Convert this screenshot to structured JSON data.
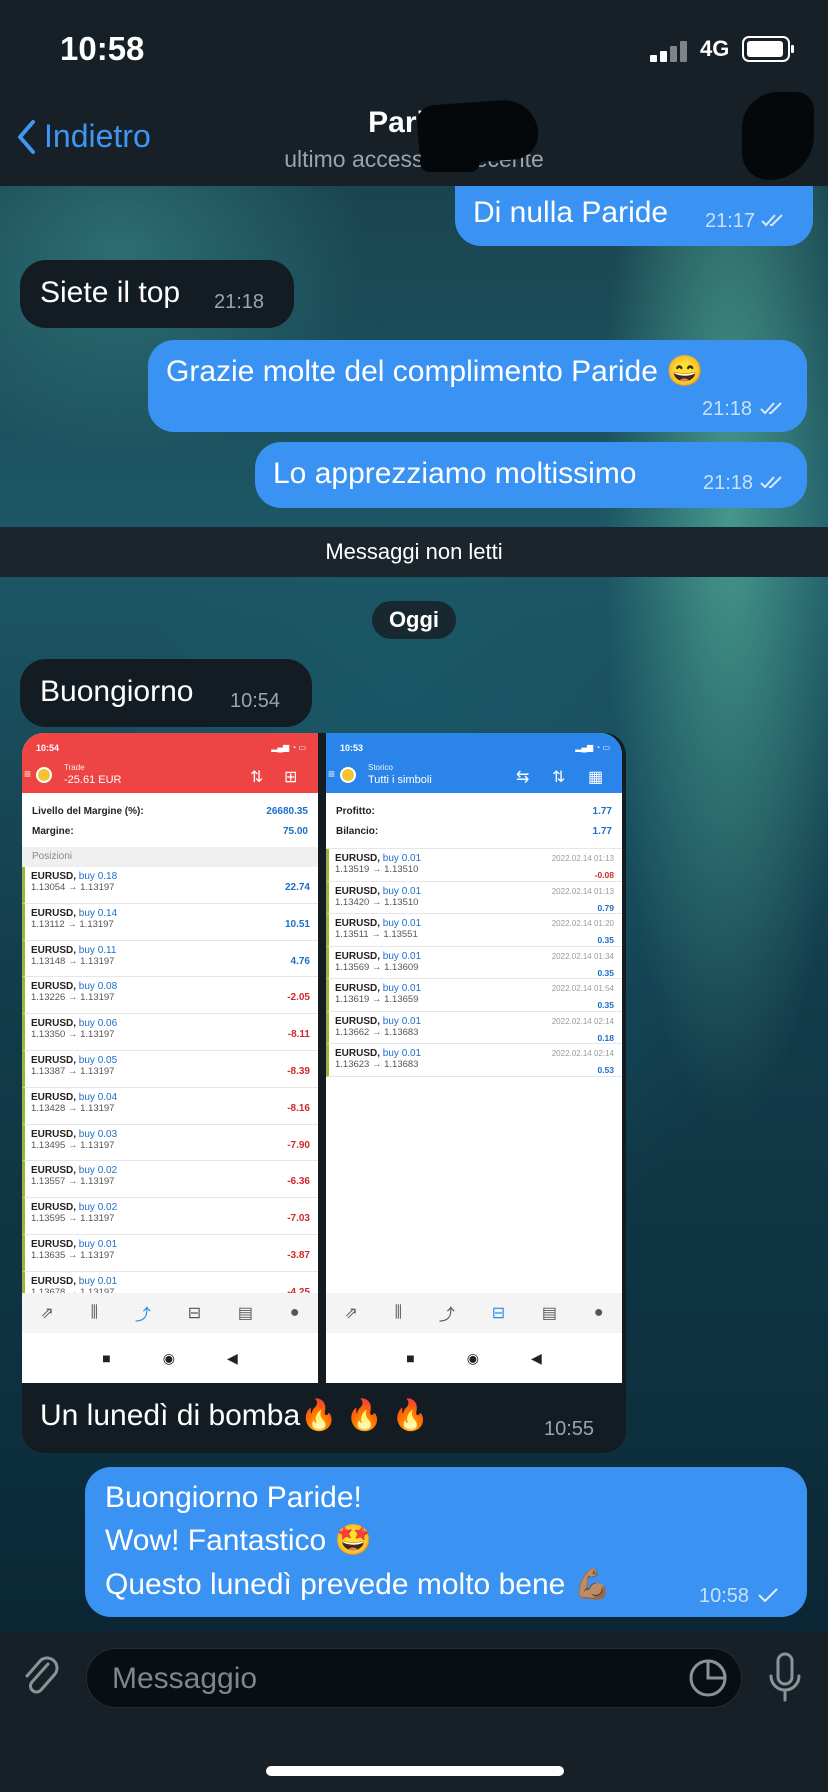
{
  "status": {
    "time": "10:58",
    "network": "4G"
  },
  "nav": {
    "back_label": "Indietro",
    "title": "Paride",
    "subtitle": "ultimo accesso di recente"
  },
  "messages": {
    "m1": {
      "text": "Di nulla Paride",
      "time": "21:17"
    },
    "m2": {
      "text": "Siete il top",
      "time": "21:18"
    },
    "m3": {
      "text": "Grazie molte del complimento Paride 😄",
      "time": "21:18"
    },
    "m4": {
      "text": "Lo apprezziamo moltissimo",
      "time": "21:18"
    },
    "unread": "Messaggi non letti",
    "date": "Oggi",
    "m5": {
      "text": "Buongiorno",
      "time": "10:54"
    },
    "m6": {
      "caption": "Un lunedì di bomba🔥 🔥 🔥",
      "time": "10:55"
    },
    "m7": {
      "line1": "Buongiorno Paride!",
      "line2": "Wow! Fantastico 🤩",
      "line3": "Questo lunedì prevede molto bene 💪🏽",
      "time": "10:58"
    }
  },
  "trade": {
    "time": "10:54",
    "header_label": "Trade",
    "header_value": "-25.61 EUR",
    "margin_level_label": "Livello del Margine (%):",
    "margin_level_value": "26680.35",
    "margin_label": "Margine:",
    "margin_value": "75.00",
    "section": "Posizioni",
    "rows": [
      {
        "sym": "EURUSD,",
        "side": "buy 0.18",
        "prices": "1.13054 → 1.13197",
        "profit": "22.74"
      },
      {
        "sym": "EURUSD,",
        "side": "buy 0.14",
        "prices": "1.13112 → 1.13197",
        "profit": "10.51"
      },
      {
        "sym": "EURUSD,",
        "side": "buy 0.11",
        "prices": "1.13148 → 1.13197",
        "profit": "4.76"
      },
      {
        "sym": "EURUSD,",
        "side": "buy 0.08",
        "prices": "1.13226 → 1.13197",
        "profit": "-2.05"
      },
      {
        "sym": "EURUSD,",
        "side": "buy 0.06",
        "prices": "1.13350 → 1.13197",
        "profit": "-8.11"
      },
      {
        "sym": "EURUSD,",
        "side": "buy 0.05",
        "prices": "1.13387 → 1.13197",
        "profit": "-8.39"
      },
      {
        "sym": "EURUSD,",
        "side": "buy 0.04",
        "prices": "1.13428 → 1.13197",
        "profit": "-8.16"
      },
      {
        "sym": "EURUSD,",
        "side": "buy 0.03",
        "prices": "1.13495 → 1.13197",
        "profit": "-7.90"
      },
      {
        "sym": "EURUSD,",
        "side": "buy 0.02",
        "prices": "1.13557 → 1.13197",
        "profit": "-6.36"
      },
      {
        "sym": "EURUSD,",
        "side": "buy 0.02",
        "prices": "1.13595 → 1.13197",
        "profit": "-7.03"
      },
      {
        "sym": "EURUSD,",
        "side": "buy 0.01",
        "prices": "1.13635 → 1.13197",
        "profit": "-3.87"
      },
      {
        "sym": "EURUSD,",
        "side": "buy 0.01",
        "prices": "1.13678 → 1.13197",
        "profit": "-4.25"
      }
    ]
  },
  "history": {
    "time": "10:53",
    "header_label": "Storico",
    "header_value": "Tutti i simboli",
    "profit_label": "Profitto:",
    "profit_value": "1.77",
    "balance_label": "Bilancio:",
    "balance_value": "1.77",
    "rows": [
      {
        "sym": "EURUSD,",
        "side": "buy 0.01",
        "prices": "1.13519 → 1.13510",
        "date": "2022.02.14 01:13",
        "profit": "-0.08"
      },
      {
        "sym": "EURUSD,",
        "side": "buy 0.01",
        "prices": "1.13420 → 1.13510",
        "date": "2022.02.14 01:13",
        "profit": "0.79"
      },
      {
        "sym": "EURUSD,",
        "side": "buy 0.01",
        "prices": "1.13511 → 1.13551",
        "date": "2022.02.14 01:20",
        "profit": "0.35"
      },
      {
        "sym": "EURUSD,",
        "side": "buy 0.01",
        "prices": "1.13569 → 1.13609",
        "date": "2022.02.14 01:34",
        "profit": "0.35"
      },
      {
        "sym": "EURUSD,",
        "side": "buy 0.01",
        "prices": "1.13619 → 1.13659",
        "date": "2022.02.14 01:54",
        "profit": "0.35"
      },
      {
        "sym": "EURUSD,",
        "side": "buy 0.01",
        "prices": "1.13662 → 1.13683",
        "date": "2022.02.14 02:14",
        "profit": "0.18"
      },
      {
        "sym": "EURUSD,",
        "side": "buy 0.01",
        "prices": "1.13623 → 1.13683",
        "date": "2022.02.14 02:14",
        "profit": "0.53"
      }
    ]
  },
  "input": {
    "placeholder": "Messaggio"
  },
  "colors": {
    "outgoing": "#3a93f2",
    "incoming": "#131c22",
    "trade_header": "#ef4444",
    "history_header": "#2a84ea",
    "link": "#3e97f4"
  }
}
